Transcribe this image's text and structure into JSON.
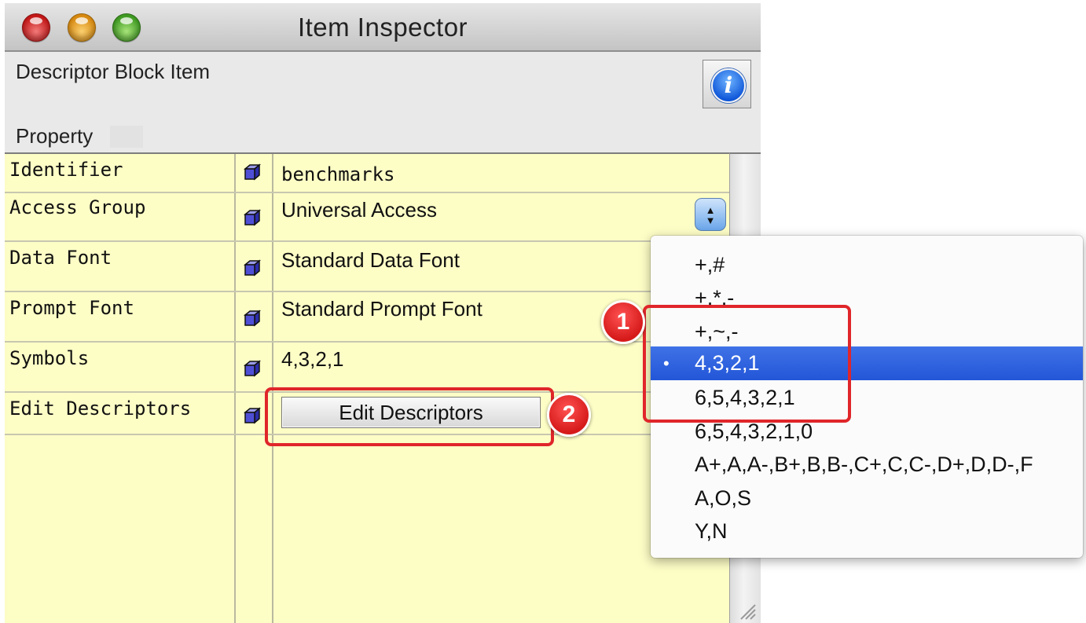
{
  "window": {
    "title": "Item Inspector",
    "block_title": "Descriptor Block Item",
    "column_header": "Property"
  },
  "properties": [
    {
      "label": "Identifier",
      "value": "benchmarks"
    },
    {
      "label": "Access Group",
      "value": "Universal Access"
    },
    {
      "label": "Data Font",
      "value": "Standard Data Font"
    },
    {
      "label": "Prompt Font",
      "value": "Standard Prompt Font"
    },
    {
      "label": "Symbols",
      "value": "4,3,2,1"
    },
    {
      "label": "Edit Descriptors",
      "button_label": "Edit Descriptors"
    }
  ],
  "popup_button": {
    "up_glyph": "▲",
    "down_glyph": "▼"
  },
  "info_button": {
    "glyph": "i",
    "icon": "info-icon"
  },
  "symbols_menu": {
    "items": [
      "+,#",
      "+,*,-",
      "+,~,-",
      "4,3,2,1",
      "6,5,4,3,2,1",
      "6,5,4,3,2,1,0",
      "A+,A,A-,B+,B,B-,C+,C,C-,D+,D,D-,F",
      "A,O,S",
      "Y,N"
    ],
    "selected": "4,3,2,1",
    "check_glyph": "•"
  },
  "annotations": {
    "badge_1": "1",
    "badge_2": "2",
    "color": "#e0262a"
  },
  "colors": {
    "grid_background": "#fdfdc6",
    "menu_selection": "#2356d8",
    "cube_icon": "#4f4fd6"
  }
}
